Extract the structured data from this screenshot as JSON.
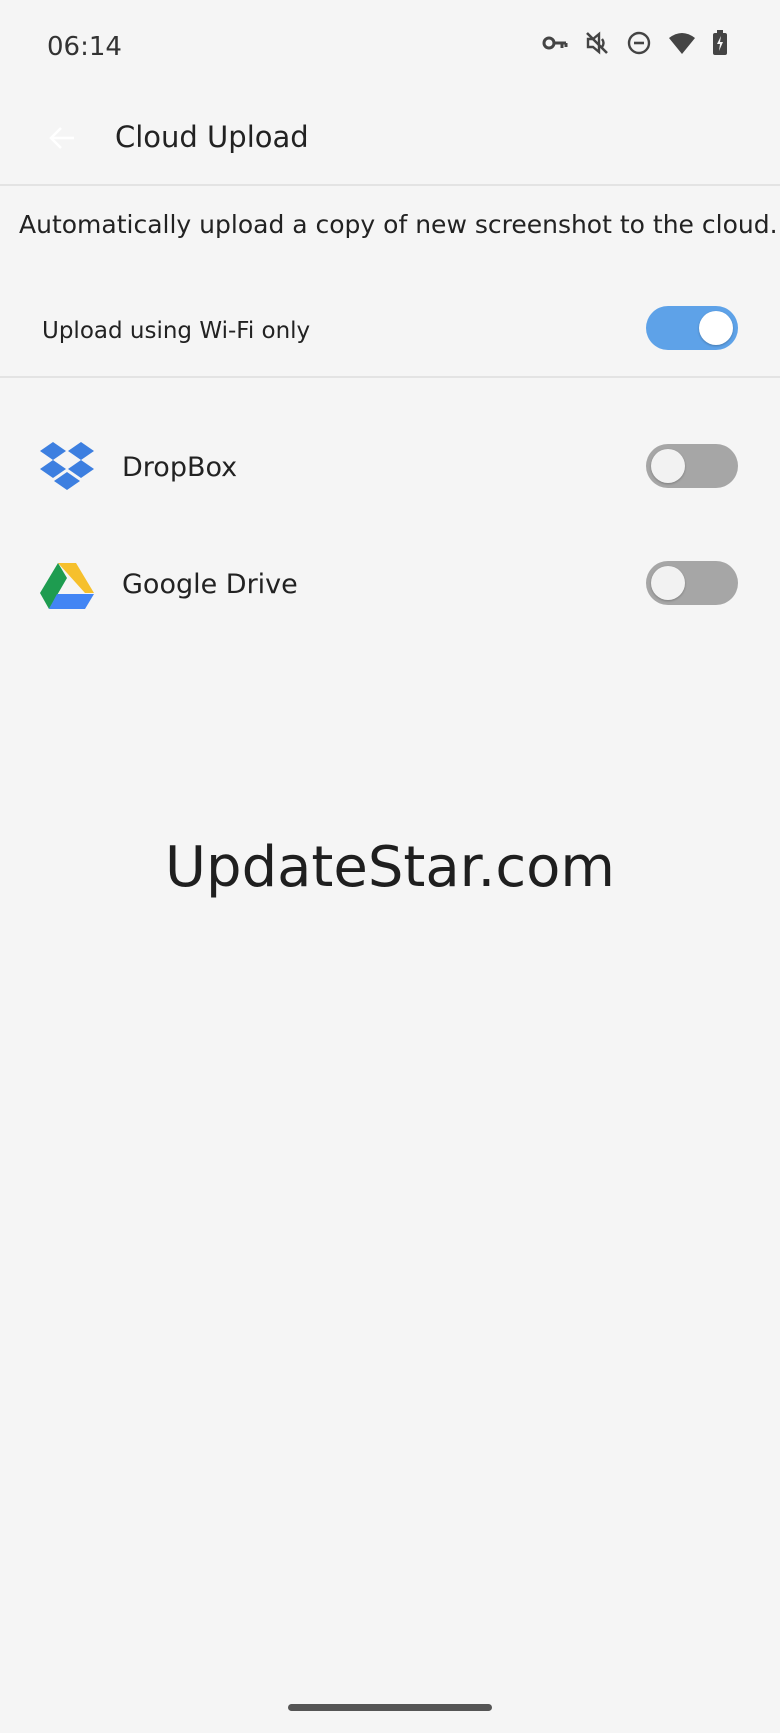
{
  "status_bar": {
    "time": "06:14",
    "icons": [
      "vpn-key-icon",
      "mute-icon",
      "do-not-disturb-icon",
      "wifi-icon",
      "battery-charging-icon"
    ]
  },
  "app_bar": {
    "back_icon": "arrow-back-icon",
    "title": "Cloud Upload"
  },
  "description": "Automatically upload a copy of new screenshot to the cloud.",
  "wifi_only": {
    "label": "Upload using Wi-Fi only",
    "enabled": true
  },
  "services": [
    {
      "name": "DropBox",
      "icon": "dropbox-icon",
      "enabled": false
    },
    {
      "name": "Google Drive",
      "icon": "google-drive-icon",
      "enabled": false
    }
  ],
  "watermark": "UpdateStar.com",
  "colors": {
    "background": "#f5f5f5",
    "toggle_on": "#5ea2e8",
    "toggle_off": "#a6a6a6",
    "dropbox_blue": "#3d7fe0",
    "drive_green": "#1e9c50",
    "drive_yellow": "#f6c02c",
    "drive_blue": "#4285f4"
  }
}
